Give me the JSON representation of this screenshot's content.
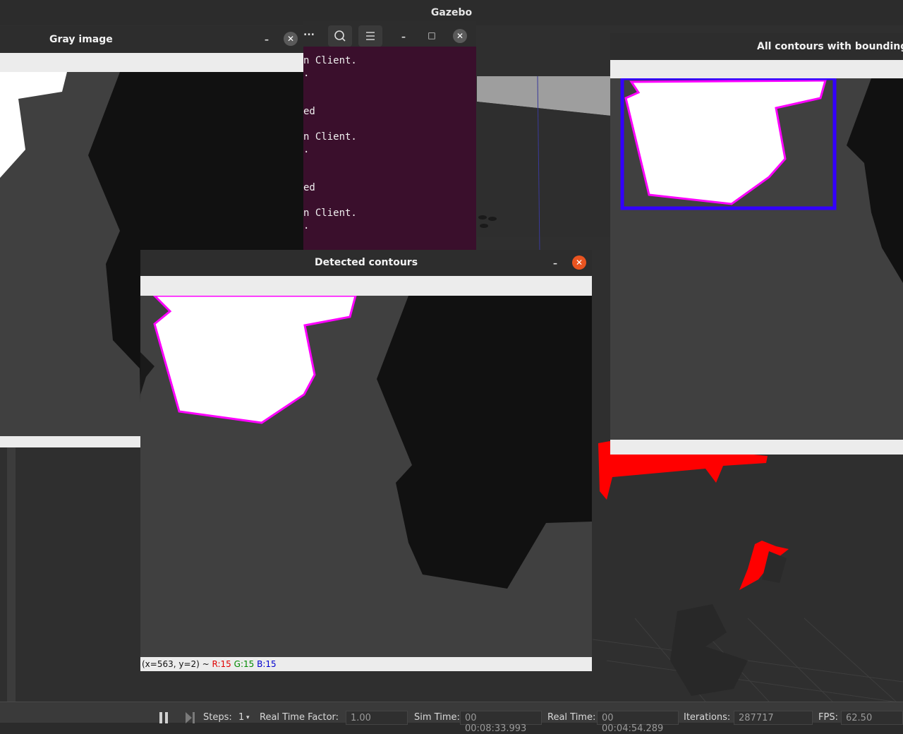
{
  "topbar": {
    "title": "Gazebo"
  },
  "terminal": {
    "lines": [
      "n Client.",
      ".",
      "ed",
      "n Client.",
      ".",
      "ed",
      "n Client.",
      "."
    ],
    "menu_dots": "..."
  },
  "gray_window": {
    "title": "Gray image"
  },
  "detected_window": {
    "title": "Detected contours",
    "status_prefix": "(x=563, y=2) ~ ",
    "status_r": "R:15",
    "status_g": "G:15",
    "status_b": "B:15"
  },
  "bbox_window": {
    "title": "All contours with bounding b"
  },
  "bottombar": {
    "steps_label": "Steps:",
    "steps_value": "1",
    "rtf_label": "Real Time Factor:",
    "rtf_value": "1.00",
    "simtime_label": "Sim Time:",
    "simtime_value": "00 00:08:33.993",
    "realtime_label": "Real Time:",
    "realtime_value": "00 00:04:54.289",
    "iterations_label": "Iterations:",
    "iterations_value": "287717",
    "fps_label": "FPS:",
    "fps_value": "62.50"
  },
  "colors": {
    "contour": "#ff00ff",
    "bbox": "#3300ff",
    "terminal_bg": "#3a0f2c",
    "close_active": "#e95420",
    "red_object": "#ff0000"
  }
}
